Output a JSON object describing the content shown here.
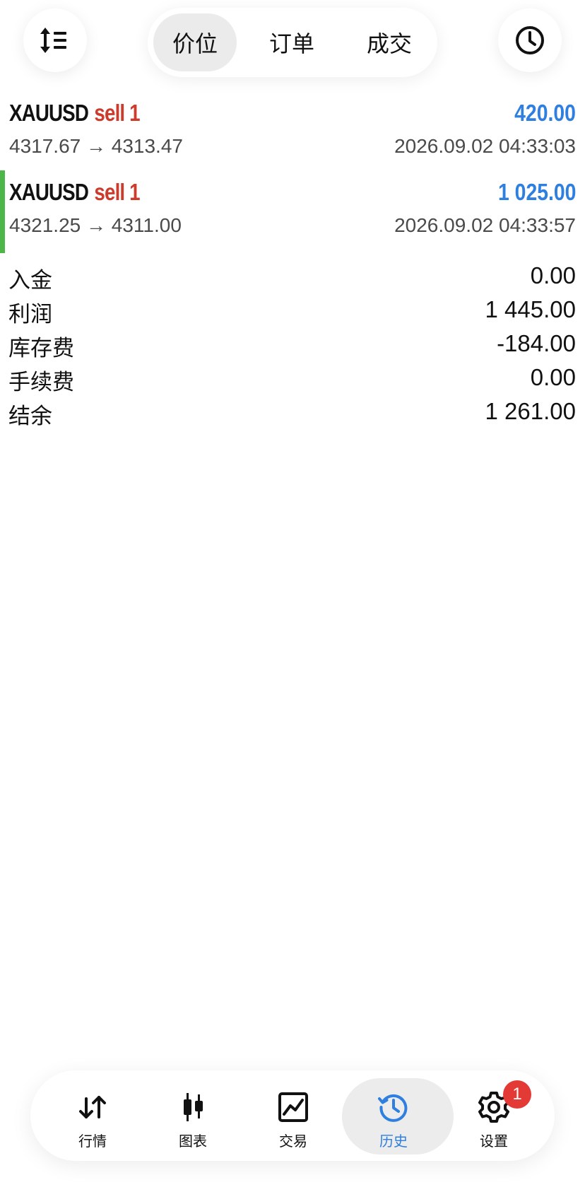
{
  "header": {
    "sort_icon": "sort-lines-icon",
    "clock_icon": "clock-icon",
    "tabs": [
      {
        "label": "价位",
        "active": true
      },
      {
        "label": "订单",
        "active": false
      },
      {
        "label": "成交",
        "active": false
      }
    ]
  },
  "deals": [
    {
      "symbol": "XAUUSD",
      "side": "sell 1",
      "profit": "420.00",
      "prices": "4317.67 → 4313.47",
      "time": "2026.09.02 04:33:03",
      "selected": false
    },
    {
      "symbol": "XAUUSD",
      "side": "sell 1",
      "profit": "1 025.00",
      "prices": "4321.25 → 4311.00",
      "time": "2026.09.02 04:33:57",
      "selected": true
    }
  ],
  "summary": [
    {
      "label": "入金",
      "value": "0.00"
    },
    {
      "label": "利润",
      "value": "1 445.00"
    },
    {
      "label": "库存费",
      "value": "-184.00"
    },
    {
      "label": "手续费",
      "value": "0.00"
    },
    {
      "label": "结余",
      "value": "1 261.00"
    }
  ],
  "nav": [
    {
      "label": "行情",
      "icon": "quotes-arrows-icon",
      "active": false
    },
    {
      "label": "图表",
      "icon": "candlestick-chart-icon",
      "active": false
    },
    {
      "label": "交易",
      "icon": "trade-chart-icon",
      "active": false
    },
    {
      "label": "历史",
      "icon": "history-clock-icon",
      "active": true
    },
    {
      "label": "设置",
      "icon": "gear-icon",
      "active": false,
      "badge": "1"
    }
  ],
  "colors": {
    "sell": "#cc3b2b",
    "profit": "#2f7fe0",
    "selected_accent": "#4cb648",
    "active_nav": "#2f7fe0",
    "badge": "#e33a35"
  }
}
